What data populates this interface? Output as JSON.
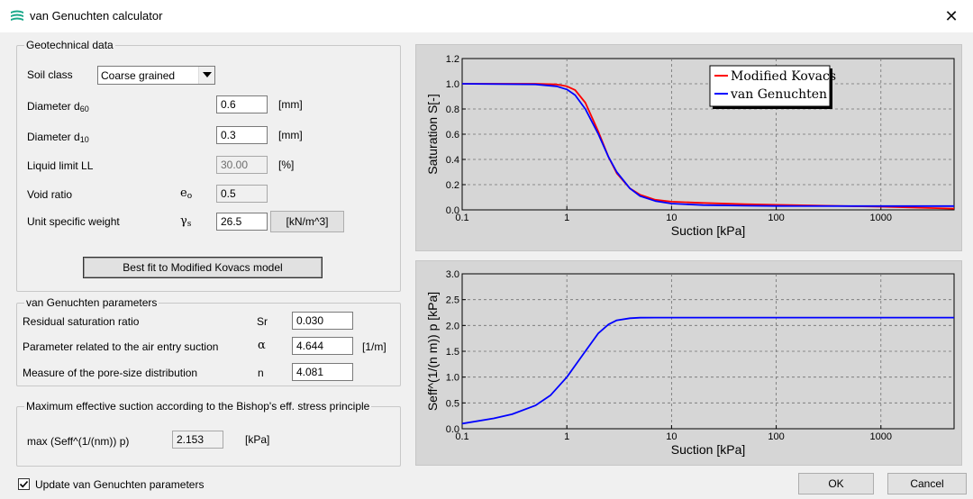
{
  "window": {
    "title": "van Genuchten calculator"
  },
  "geotech": {
    "legend": "Geotechnical data",
    "soil_class_label": "Soil class",
    "soil_class_value": "Coarse grained",
    "d60_label": "Diameter d",
    "d60_sub": "60",
    "d60_value": "0.6",
    "d60_unit": "[mm]",
    "d10_label": "Diameter d",
    "d10_sub": "10",
    "d10_value": "0.3",
    "d10_unit": "[mm]",
    "ll_label": "Liquid limit LL",
    "ll_value": "30.00",
    "ll_unit": "[%]",
    "void_label": "Void ratio",
    "void_sym": "e",
    "void_sym_sub": "o",
    "void_value": "0.5",
    "usw_label": "Unit specific weight",
    "usw_sym": "γ",
    "usw_sym_sub": "s",
    "usw_value": "26.5",
    "usw_unit_button": "[kN/m^3]",
    "bestfit_button": "Best fit to Modified Kovacs model"
  },
  "vg": {
    "legend": "van Genuchten parameters",
    "sr_label": "Residual saturation ratio",
    "sr_sym": "Sr",
    "sr_value": "0.030",
    "alpha_label": "Parameter related to the air entry suction",
    "alpha_sym": "α",
    "alpha_value": "4.644",
    "alpha_unit": "[1/m]",
    "n_label": "Measure of the pore-size distribution",
    "n_sym": "n",
    "n_value": "4.081"
  },
  "bishop": {
    "legend": "Maximum effective suction according to the Bishop's eff. stress principle",
    "max_label": "max (Seff^(1/(nm)) p)",
    "max_value": "2.153",
    "max_unit": "[kPa]"
  },
  "update_checkbox": {
    "label": "Update van Genuchten parameters",
    "checked": true
  },
  "buttons": {
    "ok": "OK",
    "cancel": "Cancel"
  },
  "colors": {
    "kovacs": "#ff0000",
    "vg": "#0000ff",
    "plot_bg": "#d6d6d6"
  },
  "chart_data": [
    {
      "type": "line",
      "xlabel": "Suction [kPa]",
      "ylabel": "Saturation S[-]",
      "xscale": "log",
      "xlim": [
        0.1,
        5000
      ],
      "ylim": [
        0,
        1.2
      ],
      "xticks": [
        "0.1",
        "1",
        "10",
        "100",
        "1000"
      ],
      "yticks": [
        "0.0",
        "0.2",
        "0.4",
        "0.6",
        "0.8",
        "1.0",
        "1.2"
      ],
      "legend_placement": "top-right",
      "grid": true,
      "series": [
        {
          "name": "Modified Kovacs",
          "x": [
            0.1,
            0.5,
            0.8,
            1.0,
            1.2,
            1.5,
            2.0,
            2.5,
            3.0,
            4.0,
            5.0,
            7.0,
            10,
            20,
            50,
            100,
            1000,
            5000
          ],
          "y": [
            1.0,
            1.0,
            0.995,
            0.98,
            0.95,
            0.85,
            0.62,
            0.42,
            0.29,
            0.17,
            0.12,
            0.08,
            0.065,
            0.055,
            0.045,
            0.04,
            0.025,
            0.01
          ]
        },
        {
          "name": "van Genuchten",
          "x": [
            0.1,
            0.5,
            0.8,
            1.0,
            1.2,
            1.5,
            2.0,
            2.5,
            3.0,
            4.0,
            5.0,
            7.0,
            10,
            20,
            50,
            100,
            1000,
            5000
          ],
          "y": [
            1.0,
            0.995,
            0.98,
            0.955,
            0.91,
            0.8,
            0.6,
            0.42,
            0.3,
            0.17,
            0.11,
            0.07,
            0.05,
            0.038,
            0.033,
            0.031,
            0.03,
            0.03
          ]
        }
      ]
    },
    {
      "type": "line",
      "xlabel": "Suction [kPa]",
      "ylabel": "Seff^(1/(n m)) p [kPa]",
      "xscale": "log",
      "xlim": [
        0.1,
        5000
      ],
      "ylim": [
        0,
        3.0
      ],
      "xticks": [
        "0.1",
        "1",
        "10",
        "100",
        "1000"
      ],
      "yticks": [
        "0.0",
        "0.5",
        "1.0",
        "1.5",
        "2.0",
        "2.5",
        "3.0"
      ],
      "grid": true,
      "series": [
        {
          "name": "",
          "x": [
            0.1,
            0.2,
            0.3,
            0.5,
            0.7,
            1.0,
            1.5,
            2.0,
            2.5,
            3.0,
            4.0,
            5.0,
            7.0,
            10,
            100,
            1000,
            5000
          ],
          "y": [
            0.1,
            0.2,
            0.28,
            0.45,
            0.65,
            1.0,
            1.5,
            1.85,
            2.02,
            2.1,
            2.14,
            2.15,
            2.153,
            2.153,
            2.153,
            2.153,
            2.153
          ]
        }
      ]
    }
  ]
}
